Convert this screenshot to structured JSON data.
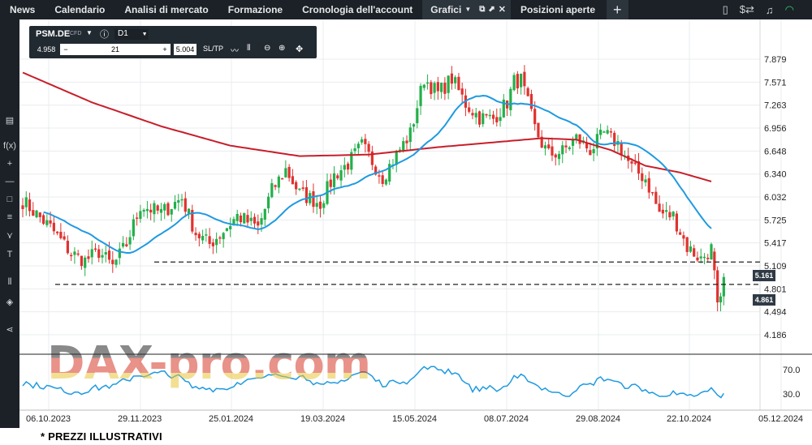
{
  "topbar": {
    "tabs": [
      "News",
      "Calendario",
      "Analisi di mercato",
      "Formazione",
      "Cronologia dell'account",
      "Grafici",
      "Posizioni aperte"
    ],
    "active_tab": "Grafici"
  },
  "toolbox": {
    "symbol": "PSM.DE",
    "symbol_type": "CFD",
    "timeframe": "D1",
    "bid": "4.958",
    "quantity": "21",
    "ask": "5.004",
    "sltp": "SL/TP"
  },
  "watermark": "DAX-pro.com",
  "footnote": "* PREZZI ILLUSTRATIVI",
  "price_tags": [
    {
      "value": "5.161",
      "price": 5.161
    },
    {
      "value": "4.861",
      "price": 4.861
    }
  ],
  "chart_data": {
    "type": "candlestick",
    "price_axis_ticks": [
      "7.879",
      "7.571",
      "7.263",
      "6.956",
      "6.648",
      "6.340",
      "6.032",
      "5.725",
      "5.417",
      "5.109",
      "4.801",
      "4.494",
      "4.186"
    ],
    "price_ylim": [
      4.186,
      7.879
    ],
    "rsi_axis_ticks": [
      "70.0",
      "30.0"
    ],
    "x_ticks": [
      "06.10.2023",
      "29.11.2023",
      "25.01.2024",
      "19.03.2024",
      "15.05.2024",
      "08.07.2024",
      "29.08.2024",
      "22.10.2024",
      "05.12.2024"
    ],
    "horizontal_levels": [
      5.161,
      4.861
    ],
    "series": [
      {
        "name": "MA fast",
        "color": "#1f9ae0"
      },
      {
        "name": "MA slow",
        "color": "#c81e2a"
      },
      {
        "name": "RSI",
        "color": "#1f9ae0"
      }
    ],
    "colors": {
      "up": "#22b04a",
      "down": "#e0322f",
      "grid": "#e9ecef"
    }
  }
}
